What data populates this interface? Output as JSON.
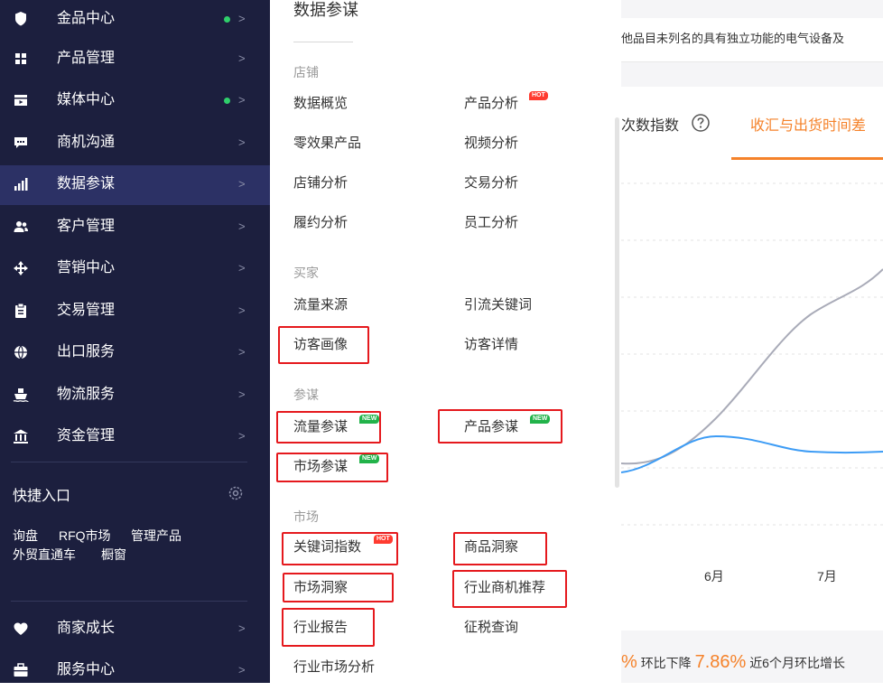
{
  "sidebar": {
    "items": [
      {
        "label": "金品中心",
        "dot": true,
        "chevron": ">"
      },
      {
        "label": "产品管理",
        "dot": false,
        "chevron": ">"
      },
      {
        "label": "媒体中心",
        "dot": true,
        "chevron": ">"
      },
      {
        "label": "商机沟通",
        "dot": false,
        "chevron": ">"
      },
      {
        "label": "数据参谋",
        "dot": false,
        "chevron": ">",
        "active": true
      },
      {
        "label": "客户管理",
        "dot": false,
        "chevron": ">"
      },
      {
        "label": "营销中心",
        "dot": false,
        "chevron": ">"
      },
      {
        "label": "交易管理",
        "dot": false,
        "chevron": ">"
      },
      {
        "label": "出口服务",
        "dot": false,
        "chevron": ">"
      },
      {
        "label": "物流服务",
        "dot": false,
        "chevron": ">"
      },
      {
        "label": "资金管理",
        "dot": false,
        "chevron": ">"
      }
    ],
    "quick_title": "快捷入口",
    "quick_links": [
      "询盘",
      "RFQ市场",
      "管理产品",
      "外贸直通车",
      "橱窗"
    ],
    "bottom_items": [
      {
        "label": "商家成长",
        "chevron": ">"
      },
      {
        "label": "服务中心",
        "chevron": ">"
      }
    ]
  },
  "panel": {
    "title": "数据参谋",
    "sections": [
      {
        "title": "店铺",
        "items": [
          "数据概览",
          "产品分析",
          "零效果产品",
          "视频分析",
          "店铺分析",
          "交易分析",
          "履约分析",
          "员工分析"
        ]
      },
      {
        "title": "买家",
        "items": [
          "流量来源",
          "引流关键词",
          "访客画像",
          "访客详情"
        ]
      },
      {
        "title": "参谋",
        "items": [
          "流量参谋",
          "产品参谋",
          "市场参谋"
        ]
      },
      {
        "title": "市场",
        "items": [
          "关键词指数",
          "商品洞察",
          "市场洞察",
          "行业商机推荐",
          "行业报告",
          "征税查询",
          "行业市场分析"
        ]
      }
    ],
    "badges": {
      "hot": "HOT",
      "new": "NEW"
    }
  },
  "content": {
    "top_text": "他品目未列名的具有独立功能的电气设备及",
    "tab1": "次数指数",
    "tab2": "收汇与出货时间差",
    "help_icon": "question-circle-icon",
    "months": [
      "6月",
      "7月"
    ],
    "bottom_prefix": "%",
    "bottom_label1": "环比下降",
    "bottom_pct": "7.86%",
    "bottom_label2": "近6个月环比增长"
  },
  "colors": {
    "sidebar_bg": "#1c1f3e",
    "accent": "#f5822a",
    "highlight": "#e5191d",
    "line_blue": "#3d9cf5",
    "line_gray": "#a9abb8"
  }
}
